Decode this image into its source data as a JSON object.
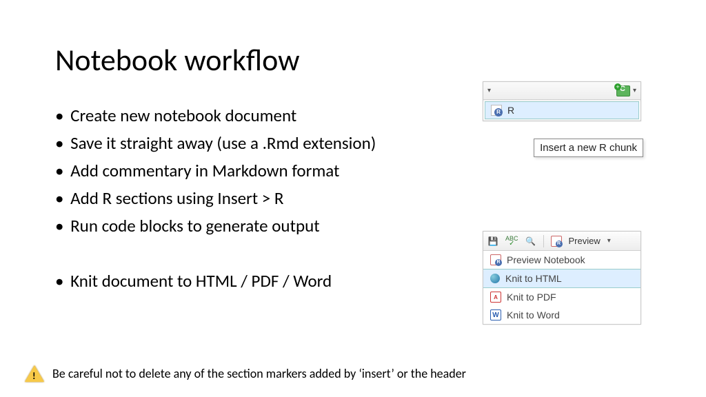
{
  "title": "Notebook workflow",
  "bullets": [
    "Create  new notebook document",
    "Save it straight away (use a .Rmd extension)",
    "Add commentary in Markdown format",
    "Add R sections using Insert > R",
    "Run code blocks to generate output",
    "Knit document to HTML / PDF / Word"
  ],
  "insert_panel": {
    "menu_item": "R",
    "tooltip": "Insert a new R chunk"
  },
  "knit_panel": {
    "toolbar_label": "Preview",
    "items": [
      "Preview Notebook",
      "Knit to HTML",
      "Knit to PDF",
      "Knit to Word"
    ]
  },
  "warning_text": "Be careful not to delete any of the section markers added by ‘insert’ or the header"
}
